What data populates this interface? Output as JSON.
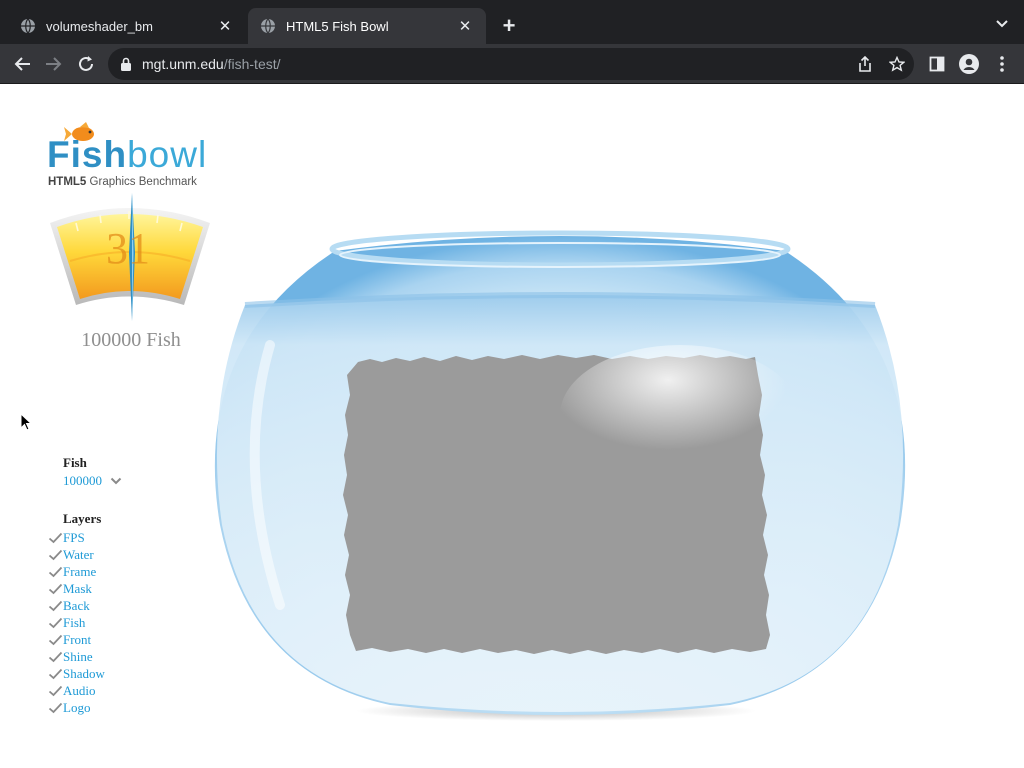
{
  "browser": {
    "tabs": [
      {
        "title": "volumeshader_bm",
        "active": false
      },
      {
        "title": "HTML5 Fish Bowl",
        "active": true
      }
    ],
    "new_tab_label": "+",
    "url_host": "mgt.unm.edu",
    "url_path": "/fish-test/",
    "close_glyph": "✕"
  },
  "logo": {
    "fish_strong": "Fish",
    "fish_light": "bowl",
    "subtitle_bold": "HTML5",
    "subtitle_rest": " Graphics Benchmark"
  },
  "gauge": {
    "fps": "31",
    "fish_count_text": "100000 Fish"
  },
  "controls": {
    "fish_heading": "Fish",
    "fish_value": "100000",
    "layers_heading": "Layers",
    "layers": [
      "FPS",
      "Water",
      "Frame",
      "Mask",
      "Back",
      "Fish",
      "Front",
      "Shine",
      "Shadow",
      "Audio",
      "Logo"
    ]
  },
  "colors": {
    "accent": "#1e9ad6",
    "chrome_dark": "#202124",
    "chrome_tab": "#35363a",
    "gauge_yellow": "#ffe14d",
    "gauge_orange": "#f6a323",
    "water": "#a8d4f0",
    "placeholder_gray": "#9b9b9b"
  }
}
